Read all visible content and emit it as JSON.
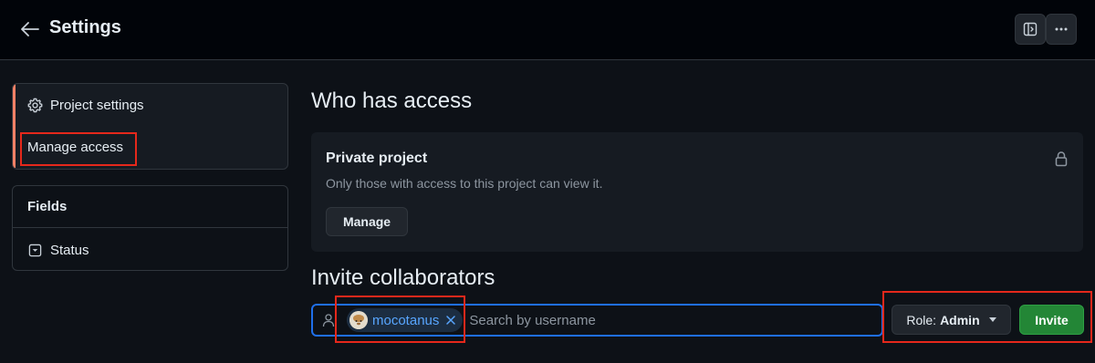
{
  "header": {
    "back_icon": "arrow-left-icon",
    "title": "Settings",
    "actions": [
      {
        "icon": "sidebar-expand-icon"
      },
      {
        "icon": "kebab-horizontal-icon"
      }
    ]
  },
  "sidebar": {
    "items": [
      {
        "label": "Project settings",
        "icon": "gear-icon",
        "active": false
      },
      {
        "label": "Manage access",
        "active": true
      }
    ],
    "active_indicator_color": "#f78166",
    "fields": {
      "title": "Fields",
      "items": [
        {
          "label": "Status",
          "icon": "single-select-icon"
        }
      ]
    }
  },
  "main": {
    "who_has_access": {
      "title": "Who has access",
      "card": {
        "title": "Private project",
        "description": "Only those with access to this project can view it.",
        "button_label": "Manage",
        "icon": "lock-icon"
      }
    },
    "invite": {
      "title": "Invite collaborators",
      "selected_user": "mocotanus",
      "search_placeholder": "Search by username",
      "role_prefix": "Role:",
      "role_value": "Admin",
      "invite_label": "Invite"
    }
  },
  "colors": {
    "background": "#0d1117",
    "accent_blue": "#1f6feb",
    "invite_green": "#238636",
    "highlight_red": "#e5281b"
  }
}
